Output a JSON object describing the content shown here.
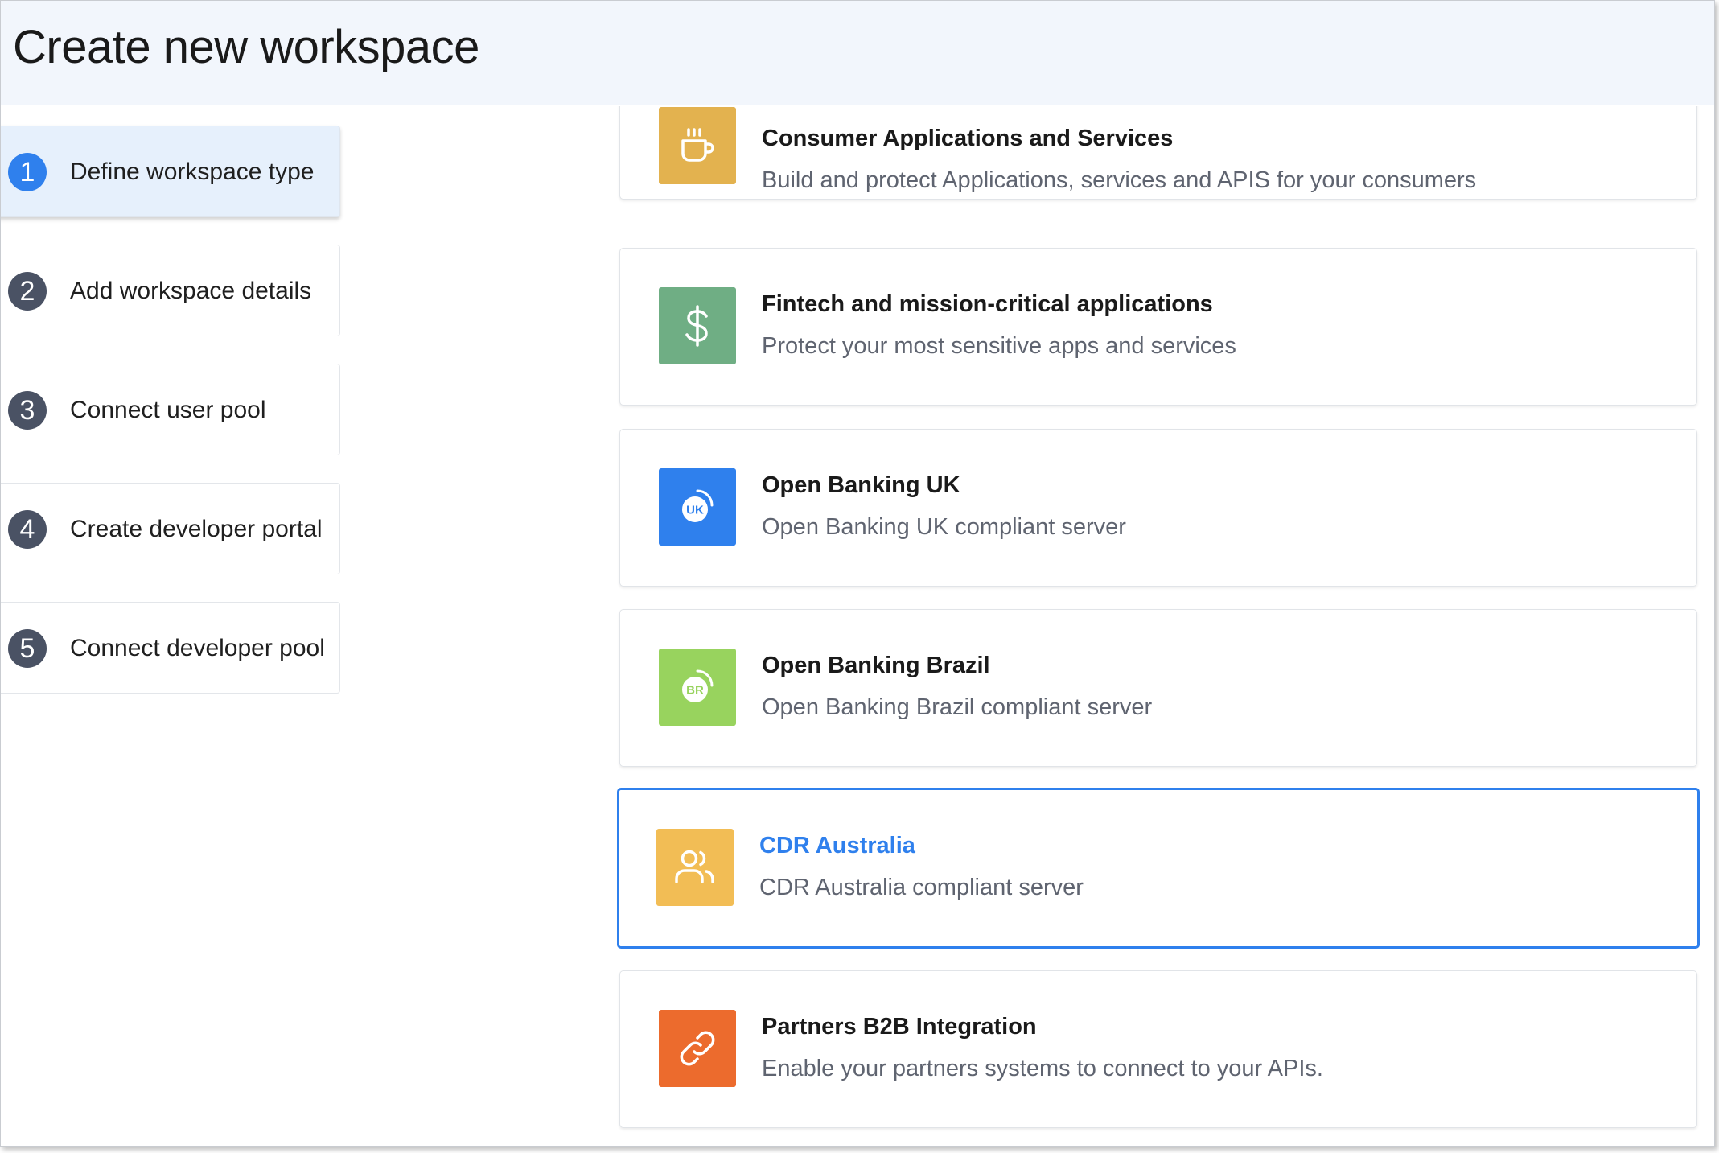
{
  "header": {
    "title": "Create new workspace"
  },
  "steps": [
    {
      "number": "1",
      "label": "Define workspace type",
      "active": true
    },
    {
      "number": "2",
      "label": "Add workspace details",
      "active": false
    },
    {
      "number": "3",
      "label": "Connect user pool",
      "active": false
    },
    {
      "number": "4",
      "label": "Create developer portal",
      "active": false
    },
    {
      "number": "5",
      "label": "Connect developer pool",
      "active": false
    }
  ],
  "workspace_types": [
    {
      "title": "Consumer Applications and Services",
      "description": "Build and protect Applications, services and APIS for your consumers",
      "icon": "coffee-cup-icon",
      "icon_color": "#e3b24f"
    },
    {
      "title": "Fintech and mission-critical applications",
      "description": "Protect your most sensitive apps and services",
      "icon": "dollar-icon",
      "icon_color": "#6fae84"
    },
    {
      "title": "Open Banking UK",
      "description": "Open Banking UK compliant server",
      "icon": "uk-badge-icon",
      "icon_color": "#2f80ed",
      "badge_text": "UK"
    },
    {
      "title": "Open Banking Brazil",
      "description": "Open Banking Brazil compliant server",
      "icon": "br-badge-icon",
      "icon_color": "#98d35e",
      "badge_text": "BR"
    },
    {
      "title": "CDR Australia",
      "description": "CDR Australia compliant server",
      "icon": "users-icon",
      "icon_color": "#f2bd55",
      "selected": true
    },
    {
      "title": "Partners B2B Integration",
      "description": "Enable your partners systems to connect to your APIs.",
      "icon": "link-icon",
      "icon_color": "#ec6b2d"
    }
  ],
  "colors": {
    "accent": "#2f80ed",
    "header_bg": "#f2f6fc",
    "step_badge": "#4a5264"
  }
}
